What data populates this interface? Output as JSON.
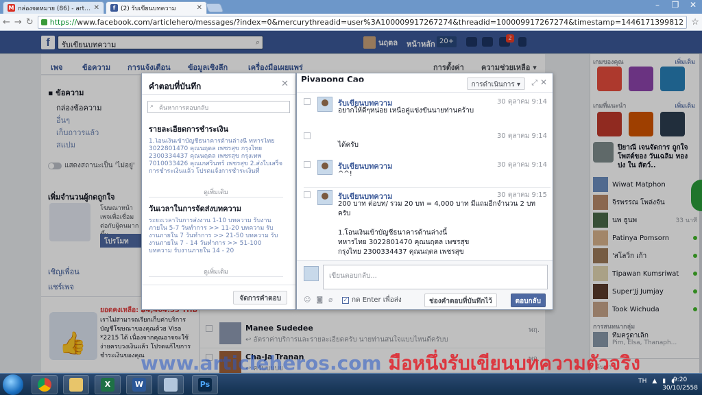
{
  "browser": {
    "tabs": [
      {
        "icon": "gmail-icon",
        "title": "กล่องจดหมาย (86) - articleh",
        "active": false
      },
      {
        "icon": "facebook-icon",
        "title": "(2) รับเขียนบทความ",
        "active": true
      }
    ],
    "url_scheme": "https://",
    "url": "www.facebook.com/articlehero/messages/?index=0&mercurythreadid=user%3A100009917267274&threadid=100009917267274&timestamp=1446171399812"
  },
  "fb": {
    "logo": "f",
    "search_value": "รับเขียนบทความ",
    "user_name": "นฤตล",
    "home_label": "หน้าหลัก",
    "home_count": "20+",
    "notif_badge": "2"
  },
  "pagenav": {
    "items": [
      "เพจ",
      "ข้อความ",
      "การแจ้งเตือน",
      "ข้อมูลเชิงลึก",
      "เครื่องมือเผยแพร่"
    ],
    "right": [
      "การตั้งค่า",
      "ความช่วยเหลือ ▾"
    ]
  },
  "leftcol": {
    "title": "ข้อความ",
    "items": [
      "กล่องข้อความ",
      "อื่นๆ",
      "เก็บถาวรแล้ว",
      "สแปม"
    ],
    "toggle_label": "แสดงสถานะเป็น 'ไม่อยู่'",
    "promo_title": "เพิ่มจำนวนผู้กดถูกใจ",
    "promo_text": "โฆษณาหน้าเพจเพื่อเชื่อมต่อกับผู้คนมากขึ้น",
    "promo_button": "โปรโมท",
    "links": [
      "เชิญเพื่อน",
      "แชร์เพจ"
    ]
  },
  "leftbottom": {
    "price": "ยอดคงเหลือ: ฿4,464.33 THB",
    "text": "เราไม่สามารถเรียกเก็บค่าบริการบัญชีโฆษณาของคุณด้วย Visa *2215 ได้ เนื่องจากคุณอาจจะใช้ง่ายครบวงเงินแล้ว โปรดแก้ไขการชำระเงินของคุณ"
  },
  "msglist": [
    {
      "name": "Manee Sudedee",
      "snippet": "↩ อัตราค่าบริการและรายละเอียดครับ นายท่านสนใจแบบไหนดีครับบ",
      "date": "พฤ."
    },
    {
      "name": "Cha-Ja Tranan",
      "snippet": "↩ ครับบบบย",
      "date": "พฤ."
    }
  ],
  "saved_replies": {
    "title": "คำตอบที่บันทึก",
    "search_placeholder": "ค้นหาการตอบกลับ",
    "items": [
      {
        "title": "รายละเอียดการชำระเงิน",
        "body": "1.โอนเงินเข้าบัญชีธนาคารด้านล่างนี้ ทหารไทย 3022801470 คุณนฤตล เพชรสุข กรุงไทย 2300334437 คุณนฤตล เพชรสุข กรุงเทพ 7010033426 คุณเกศรินทร์ เพชรสุข 2.ส่งใบเสร็จการชำระเงินแล้ว โปรดแจ้งการชำระเงินที่",
        "more": "ดูเพิ่มเติม"
      },
      {
        "title": "วันเวลาในการจัดส่งบทความ",
        "body": "ระยะเวลาในการส่งงาน 1-10 บทความ รับงานภายใน 5-7 วันทำการ >> 11-20 บทความ รับงานภายใน 7 วันทำการ >> 21-50 บทความ รับงานภายใน 7 - 14 วันทำการ >> 51-100 บทความ รับงานภายใน 14 - 20",
        "more": "ดูเพิ่มเติม"
      }
    ],
    "manage_button": "จัดการคำตอบ"
  },
  "conversation": {
    "name": "Piyapong Cao",
    "actions_label": "การดำเนินการ ▾",
    "messages": [
      {
        "sender": "รับเขียนบทความ",
        "time": "30 ตุลาคม 9:14",
        "text": "อยากให้ดีๆหน่อย เหนือคู่แข่งขันนายท่านคร้าบ"
      },
      {
        "sender": "",
        "time": "30 ตุลาคม 9:14",
        "text": "ได้ครับ"
      },
      {
        "sender": "รับเขียนบทความ",
        "time": "30 ตุลาคม 9:14",
        "text": "^^!"
      },
      {
        "sender": "รับเขียนบทความ",
        "time": "30 ตุลาคม 9:15",
        "text": "200 บาท ต่อบท/ รวม 20 บท = 4,000 บาท มีแถมอีกจำนวน 2 บทครับ\n\n1.โอนเงินเข้าบัญชีธนาคารด้านล่างนี้\nทหารไทย 3022801470 คุณนฤตล เพชรสุข\nกรุงไทย 2300334437 คุณนฤตล เพชรสุข"
      }
    ],
    "compose_placeholder": "เขียนตอบกลับ...",
    "enter_label": "กด Enter เพื่อส่ง",
    "saved_button": "ช่องคำตอบที่บันทึกไว้",
    "send_button": "ตอบกลับ"
  },
  "rightbar": {
    "games_head": "เกมของคุณ",
    "games_more": "เพิ่มเติม",
    "suggested_head": "เกมที่แนะนำ",
    "suggested_more": "เพิ่มเติม",
    "game_text": "ปิยาณี เจนจัดการ ถูกใจโพสต์ของ วันเฉลิม ทอง ปง ใน สัตว์..",
    "friends": [
      {
        "name": "Wiwat Matphon",
        "status": ""
      },
      {
        "name": "จิรพรรณ โพล่งจัน",
        "status": ""
      },
      {
        "name": "นพ ธูนพ",
        "status": "33 นาที"
      },
      {
        "name": "Patinya Pomsorn",
        "status": ""
      },
      {
        "name": "'สโลวิ่ก เก้า",
        "status": ""
      },
      {
        "name": "Tipawan Kumsriwat",
        "status": ""
      },
      {
        "name": "Super'Jj Jumjay",
        "status": ""
      },
      {
        "name": "Took Wichuda",
        "status": ""
      }
    ],
    "conversations_head": "การสนทนากลุ่ม",
    "group_name": "ทีมครูดาเล็ก",
    "group_members": "Pim, Elsa, Thanaph...",
    "search_label": "ค้นหา"
  },
  "watermark": {
    "latin": "www.articleheros.com",
    "thai": "มือหนึ่งรับเขียนบทความตัวจริง"
  },
  "taskbar": {
    "lang": "TH",
    "time": "9:20",
    "date": "30/10/2558"
  },
  "colors": {
    "fb_blue": "#3b5998",
    "link_blue": "#6d84b4",
    "watermark_red": "#e11e28"
  }
}
